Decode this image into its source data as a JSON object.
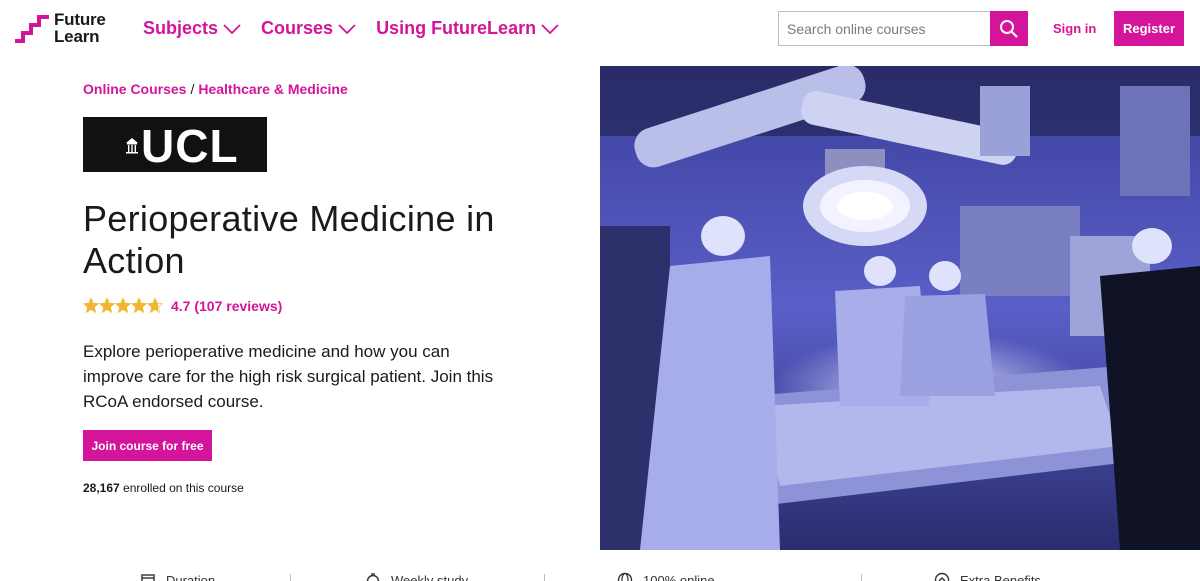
{
  "brand": {
    "line1": "Future",
    "line2": "Learn",
    "color": "#d4149a"
  },
  "nav": [
    {
      "label": "Subjects"
    },
    {
      "label": "Courses"
    },
    {
      "label": "Using FutureLearn"
    }
  ],
  "search": {
    "placeholder": "Search online courses"
  },
  "auth": {
    "signin_label": "Sign in",
    "register_label": "Register"
  },
  "breadcrumb": {
    "items": [
      "Online Courses",
      "Healthcare & Medicine"
    ],
    "separator": "/"
  },
  "provider": {
    "logo_text": "UCL"
  },
  "course": {
    "title": "Perioperative Medicine in Action",
    "rating_text": "4.7 (107 reviews)",
    "rating_value": 4.7,
    "description": "Explore perioperative medicine and how you can improve care for the high risk surgical patient. Join this RCoA endorsed course.",
    "join_label": "Join course for free",
    "enrolled_count": "28,167",
    "enrolled_suffix": "enrolled on this course"
  },
  "features": [
    {
      "icon": "calendar-icon",
      "label": "Duration"
    },
    {
      "icon": "weekly-study-icon",
      "label": "Weekly study"
    },
    {
      "icon": "globe-icon",
      "label": "100% online"
    },
    {
      "icon": "upgrade-icon",
      "label": "Extra Benefits"
    }
  ]
}
